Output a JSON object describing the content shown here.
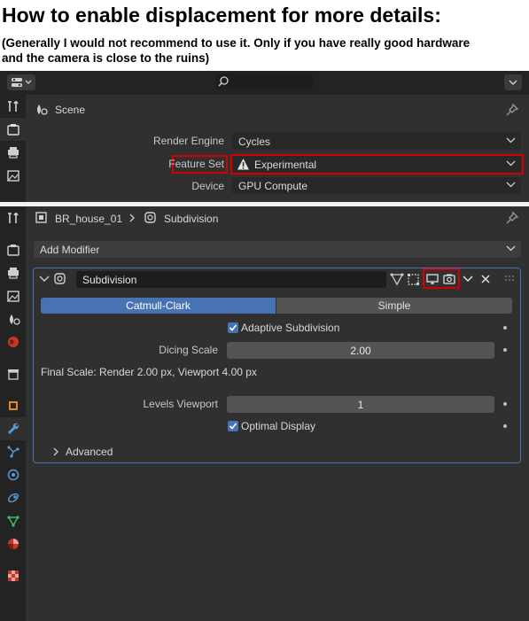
{
  "caption": {
    "title": "How to enable displacement for more details:",
    "subtitle_line1": "(Generally I would not recommend to use it. Only if you have really good hardware",
    "subtitle_line2": "and the camera is close to the ruins)"
  },
  "render_panel": {
    "context": "Scene",
    "rows": [
      {
        "label": "Render Engine",
        "value": "Cycles"
      },
      {
        "label": "Feature Set",
        "value": "Experimental"
      },
      {
        "label": "Device",
        "value": "GPU Compute"
      }
    ]
  },
  "modifier_panel": {
    "breadcrumb": {
      "object": "BR_house_01",
      "modifier": "Subdivision"
    },
    "add_modifier": "Add Modifier",
    "modifier_name": "Subdivision",
    "tabs": {
      "catmull": "Catmull-Clark",
      "simple": "Simple",
      "active": "Catmull-Clark"
    },
    "adaptive_subdivision": "Adaptive Subdivision",
    "dicing_scale": {
      "label": "Dicing Scale",
      "value": "2.00"
    },
    "final_scale": "Final Scale: Render 2.00 px, Viewport 4.00 px",
    "levels_viewport": {
      "label": "Levels Viewport",
      "value": "1"
    },
    "optimal_display": "Optimal Display",
    "advanced": "Advanced"
  },
  "colors": {
    "accent": "#4772b3",
    "highlight": "#d40000",
    "panel": "#303030",
    "sidebar": "#232323"
  }
}
